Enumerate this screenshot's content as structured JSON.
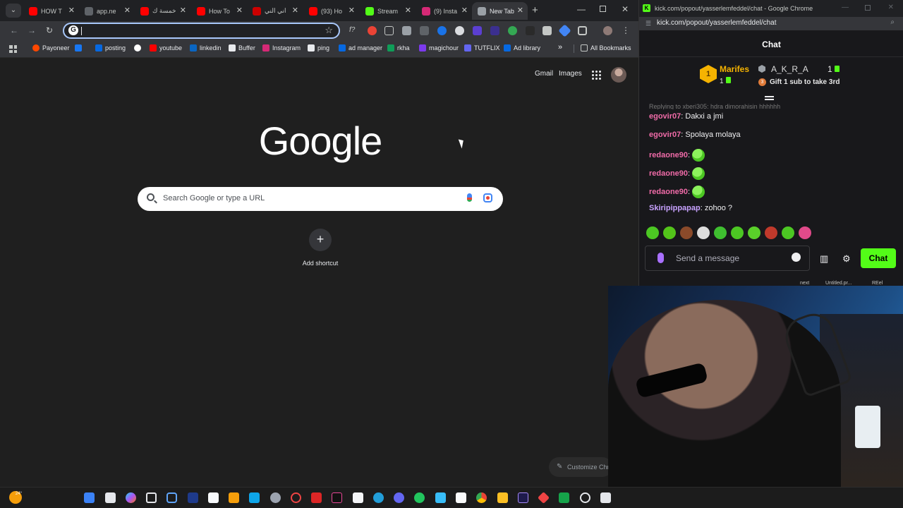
{
  "chrome": {
    "tabs": [
      {
        "title": "HOW T",
        "favicon": "youtube-icon",
        "color": "#ff0000"
      },
      {
        "title": "app.ne",
        "favicon": "web-icon",
        "color": "#5f6368"
      },
      {
        "title": "خمسة ك",
        "favicon": "youtube-icon",
        "color": "#ff0000"
      },
      {
        "title": "How To",
        "favicon": "youtube-icon",
        "color": "#ff0000"
      },
      {
        "title": "اني الني",
        "favicon": "youtube-badge-icon",
        "color": "#cc0000"
      },
      {
        "title": "(93) Ho",
        "favicon": "youtube-icon",
        "color": "#ff0000"
      },
      {
        "title": "Stream",
        "favicon": "kick-icon",
        "color": "#53fc18"
      },
      {
        "title": "(9) Insta",
        "favicon": "instagram-icon",
        "color": "#d62976"
      },
      {
        "title": "New Tab",
        "favicon": "chrome-icon",
        "color": "#9aa0a6",
        "active": true
      }
    ],
    "omnibox": {
      "value": ""
    },
    "bookmarks": [
      {
        "label": "Payoneer",
        "icon": "payoneer-icon",
        "color": "#ff4800"
      },
      {
        "label": "",
        "icon": "facebook-icon",
        "color": "#1877f2"
      },
      {
        "label": "posting",
        "icon": "meta-icon",
        "color": "#0668e1"
      },
      {
        "label": "",
        "icon": "google-icon",
        "color": "#ffffff"
      },
      {
        "label": "youtube",
        "icon": "youtube-icon",
        "color": "#ff0000"
      },
      {
        "label": "linkedin",
        "icon": "linkedin-icon",
        "color": "#0a66c2"
      },
      {
        "label": "Buffer",
        "icon": "buffer-icon",
        "color": "#e8eaed"
      },
      {
        "label": "Instagram",
        "icon": "instagram-icon",
        "color": "#d62976"
      },
      {
        "label": "ping",
        "icon": "ping-icon",
        "color": "#e8eaed"
      },
      {
        "label": "ad manager",
        "icon": "meta-icon",
        "color": "#0668e1"
      },
      {
        "label": "rkha",
        "icon": "sheets-icon",
        "color": "#0f9d58"
      },
      {
        "label": "magichour",
        "icon": "magichour-icon",
        "color": "#7c3aed"
      },
      {
        "label": "TUTFLIX",
        "icon": "tutflix-icon",
        "color": "#6366f1"
      },
      {
        "label": "Ad library",
        "icon": "meta-icon",
        "color": "#0668e1"
      }
    ],
    "bookmarks_more": "»",
    "all_bookmarks": "All Bookmarks",
    "newtab": {
      "gmail": "Gmail",
      "images": "Images",
      "logo": "Google",
      "search_placeholder": "Search Google or type a URL",
      "add_shortcut": "Add shortcut",
      "customize": "Customize Chrome"
    }
  },
  "kick": {
    "window_title": "kick.com/popout/yasserlemfeddel/chat - Google Chrome",
    "url": "kick.com/popout/yasserlemfeddel/chat",
    "header": "Chat",
    "pinned": {
      "rank": "1",
      "top_gifter": "Marifes",
      "top_gifter_count": "1",
      "second_gifter": "A_K_R_A",
      "second_gifter_count": "1",
      "gift_rank": "3",
      "gift_text": "Gift 1 sub to take 3rd"
    },
    "reply_hint": "Replying to xberi305: hdra dimorahisin hhhhhh",
    "messages": [
      {
        "user": "egovir07",
        "color": "#f06ba8",
        "text": "Dakxi a jmi"
      },
      {
        "user": "egovir07",
        "color": "#f06ba8",
        "text": "Spolaya molaya"
      },
      {
        "user": "redaone90",
        "color": "#f06ba8",
        "text": "",
        "emote": "pepe-emote"
      },
      {
        "user": "redaone90",
        "color": "#f06ba8",
        "text": "",
        "emote": "pepe-emote"
      },
      {
        "user": "redaone90",
        "color": "#f06ba8",
        "text": "",
        "emote": "pepe-emote"
      },
      {
        "user": "Skiripippapap",
        "color": "#c8a2ff",
        "text": "zohoo ?"
      }
    ],
    "composer_placeholder": "Send a message",
    "send_label": "Chat",
    "footer": [
      "next",
      "Untitled.pr...",
      "REel"
    ]
  },
  "taskbar": {
    "temperature": "24°"
  },
  "colors": {
    "kick_green": "#53fc18",
    "chrome_dark": "#1f1f1f",
    "omnibox_focus": "#a8c7fa"
  }
}
